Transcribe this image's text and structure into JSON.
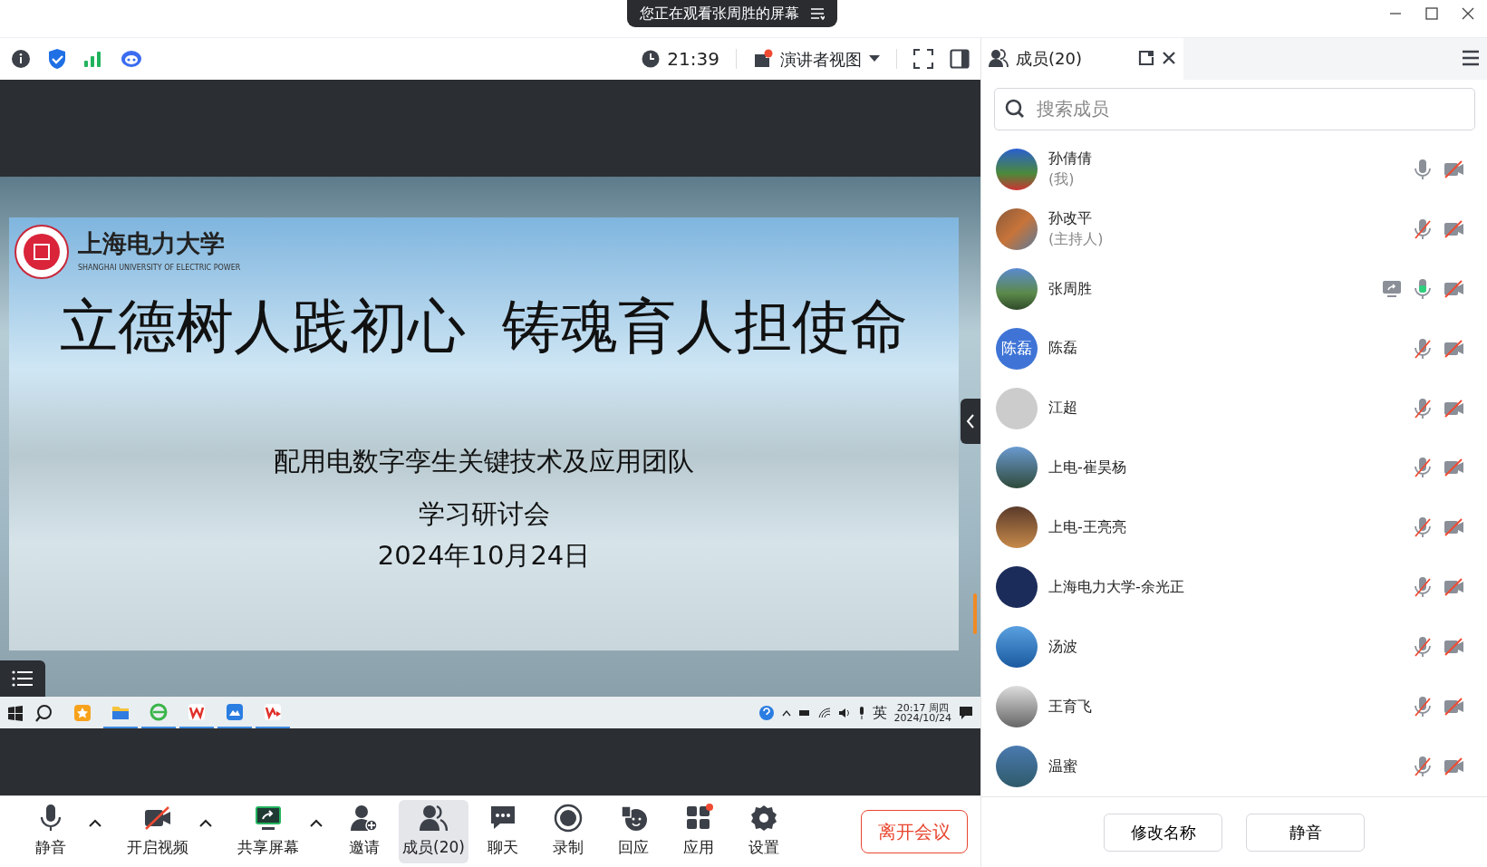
{
  "banner": {
    "text": "您正在观看张周胜的屏幕"
  },
  "toolbar": {
    "time": "21:39",
    "view_label": "演讲者视图",
    "view_badge": true
  },
  "slide": {
    "logo_name": "上海电力大学",
    "logo_subtitle": "SHANGHAI UNIVERSITY OF ELECTRIC POWER",
    "title": "立德树人践初心  铸魂育人担使命",
    "lines": [
      "配用电数字孪生关键技术及应用团队",
      "学习研讨会",
      "2024年10月24日"
    ]
  },
  "remote_taskbar": {
    "apps": [
      {
        "active": false
      },
      {
        "active": true
      },
      {
        "active": true
      },
      {
        "active": true
      },
      {
        "active": true
      },
      {
        "active": true
      }
    ],
    "ime": "英",
    "clock_time": "20:17 周四",
    "clock_date": "2024/10/24"
  },
  "bottom_bar": {
    "items": [
      {
        "label": "静音",
        "has_menu": true,
        "selected": false
      },
      {
        "label": "开启视频",
        "has_menu": true,
        "selected": false
      },
      {
        "label": "共享屏幕",
        "has_menu": true,
        "selected": false
      },
      {
        "label": "邀请",
        "selected": false
      },
      {
        "label": "成员(20)",
        "selected": true
      },
      {
        "label": "聊天",
        "selected": false
      },
      {
        "label": "录制",
        "selected": false
      },
      {
        "label": "回应",
        "selected": false
      },
      {
        "label": "应用",
        "selected": false,
        "badge": true
      },
      {
        "label": "设置",
        "selected": false
      }
    ],
    "leave_button": "离开会议"
  },
  "panel": {
    "tab_label": "成员(20)",
    "search": {
      "placeholder": "搜索成员"
    },
    "members": [
      {
        "name": "孙倩倩",
        "role": "(我)",
        "muted": false,
        "video": false
      },
      {
        "name": "孙改平",
        "role": "(主持人)",
        "muted": true,
        "video": false
      },
      {
        "name": "张周胜",
        "muted": false,
        "speaking": true,
        "sharing": true,
        "video": false
      },
      {
        "name": "陈磊",
        "avatar_text": "陈磊",
        "muted": true,
        "video": false
      },
      {
        "name": "江超",
        "muted": true,
        "video": false
      },
      {
        "name": "上电-崔昊杨",
        "muted": true,
        "video": false
      },
      {
        "name": "上电-王亮亮",
        "muted": true,
        "video": false
      },
      {
        "name": "上海电力大学-余光正",
        "muted": true,
        "video": false
      },
      {
        "name": "汤波",
        "muted": true,
        "video": false
      },
      {
        "name": "王育飞",
        "muted": true,
        "video": false
      },
      {
        "name": "温蜜",
        "muted": true,
        "video": false
      }
    ],
    "buttons": [
      "修改名称",
      "静音"
    ]
  }
}
